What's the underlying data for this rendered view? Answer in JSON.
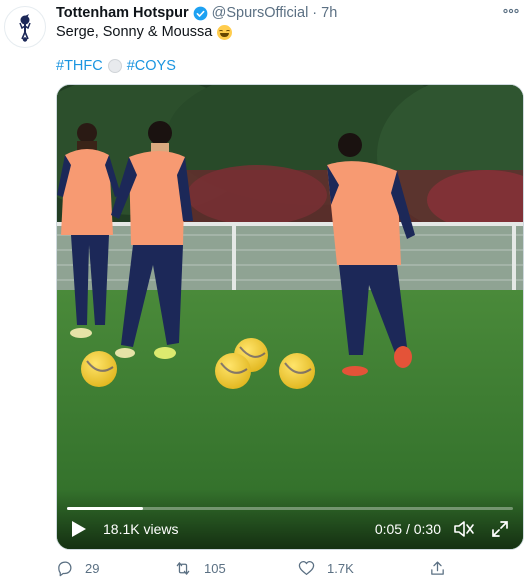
{
  "author": {
    "display_name": "Tottenham Hotspur",
    "handle": "@SpursOfficial",
    "separator": "·",
    "timestamp": "7h"
  },
  "tweet": {
    "text": "Serge, Sonny & Moussa",
    "hashtags": [
      "#THFC",
      "#COYS"
    ]
  },
  "video": {
    "views": "18.1K views",
    "time": "0:05 / 0:30",
    "progress": 0.17
  },
  "actions": {
    "replies": "29",
    "retweets": "105",
    "likes": "1.7K"
  },
  "colors": {
    "accent": "#1b95e0",
    "verified": "#1da1f2",
    "muted": "#5b7083",
    "kit_orange": "#f79a72",
    "kit_navy": "#1c2858"
  },
  "icons": [
    "spurs-crest-icon",
    "verified-badge-icon",
    "more-options-icon",
    "grin-emoji-icon",
    "soccer-ball-emoji-icon",
    "play-icon",
    "volume-icon",
    "fullscreen-icon",
    "reply-icon",
    "retweet-icon",
    "like-icon",
    "share-icon"
  ]
}
